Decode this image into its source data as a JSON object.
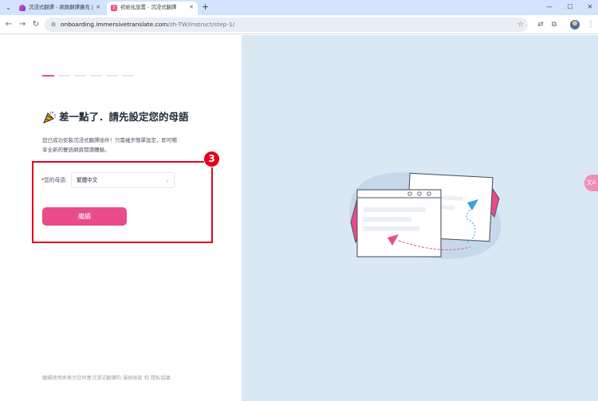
{
  "browser": {
    "tabs": [
      {
        "title": "沉浸式翻譯 - 網頁翻譯擴充 | 雙",
        "active": false
      },
      {
        "title": "初始化設置 - 沉浸式翻譯",
        "active": true,
        "favicon_text": "文"
      }
    ],
    "address": {
      "host": "onboarding.immersivetranslate.com",
      "path": "/zh-TW/instruct/step-1/"
    }
  },
  "onboarding": {
    "progress": {
      "total_steps": 6,
      "current_step": 1
    },
    "heading": "差一點了．請先設定您的母語",
    "intro_line1": "您已成功安裝沉浸式翻譯插件！只需幾步簡單設定，即可暢",
    "intro_line2": "享全新的雙語網頁閱讀體驗。",
    "annotation_step": "3",
    "native_language": {
      "required_mark": "*",
      "label": "您的母語:",
      "selected": "繁體中文"
    },
    "continue_label": "繼續",
    "footer": {
      "prefix": "繼續使用即表示您同意沉浸式翻譯的",
      "terms": "服務條款",
      "and": "和",
      "privacy": "隱私協議"
    },
    "float_button_label": "文A"
  },
  "colors": {
    "brand_pink": "#ea4c89",
    "annotation_red": "#e3001b",
    "right_pane_bg": "#dae8f4",
    "tabbar_bg": "#d3e3fd"
  }
}
